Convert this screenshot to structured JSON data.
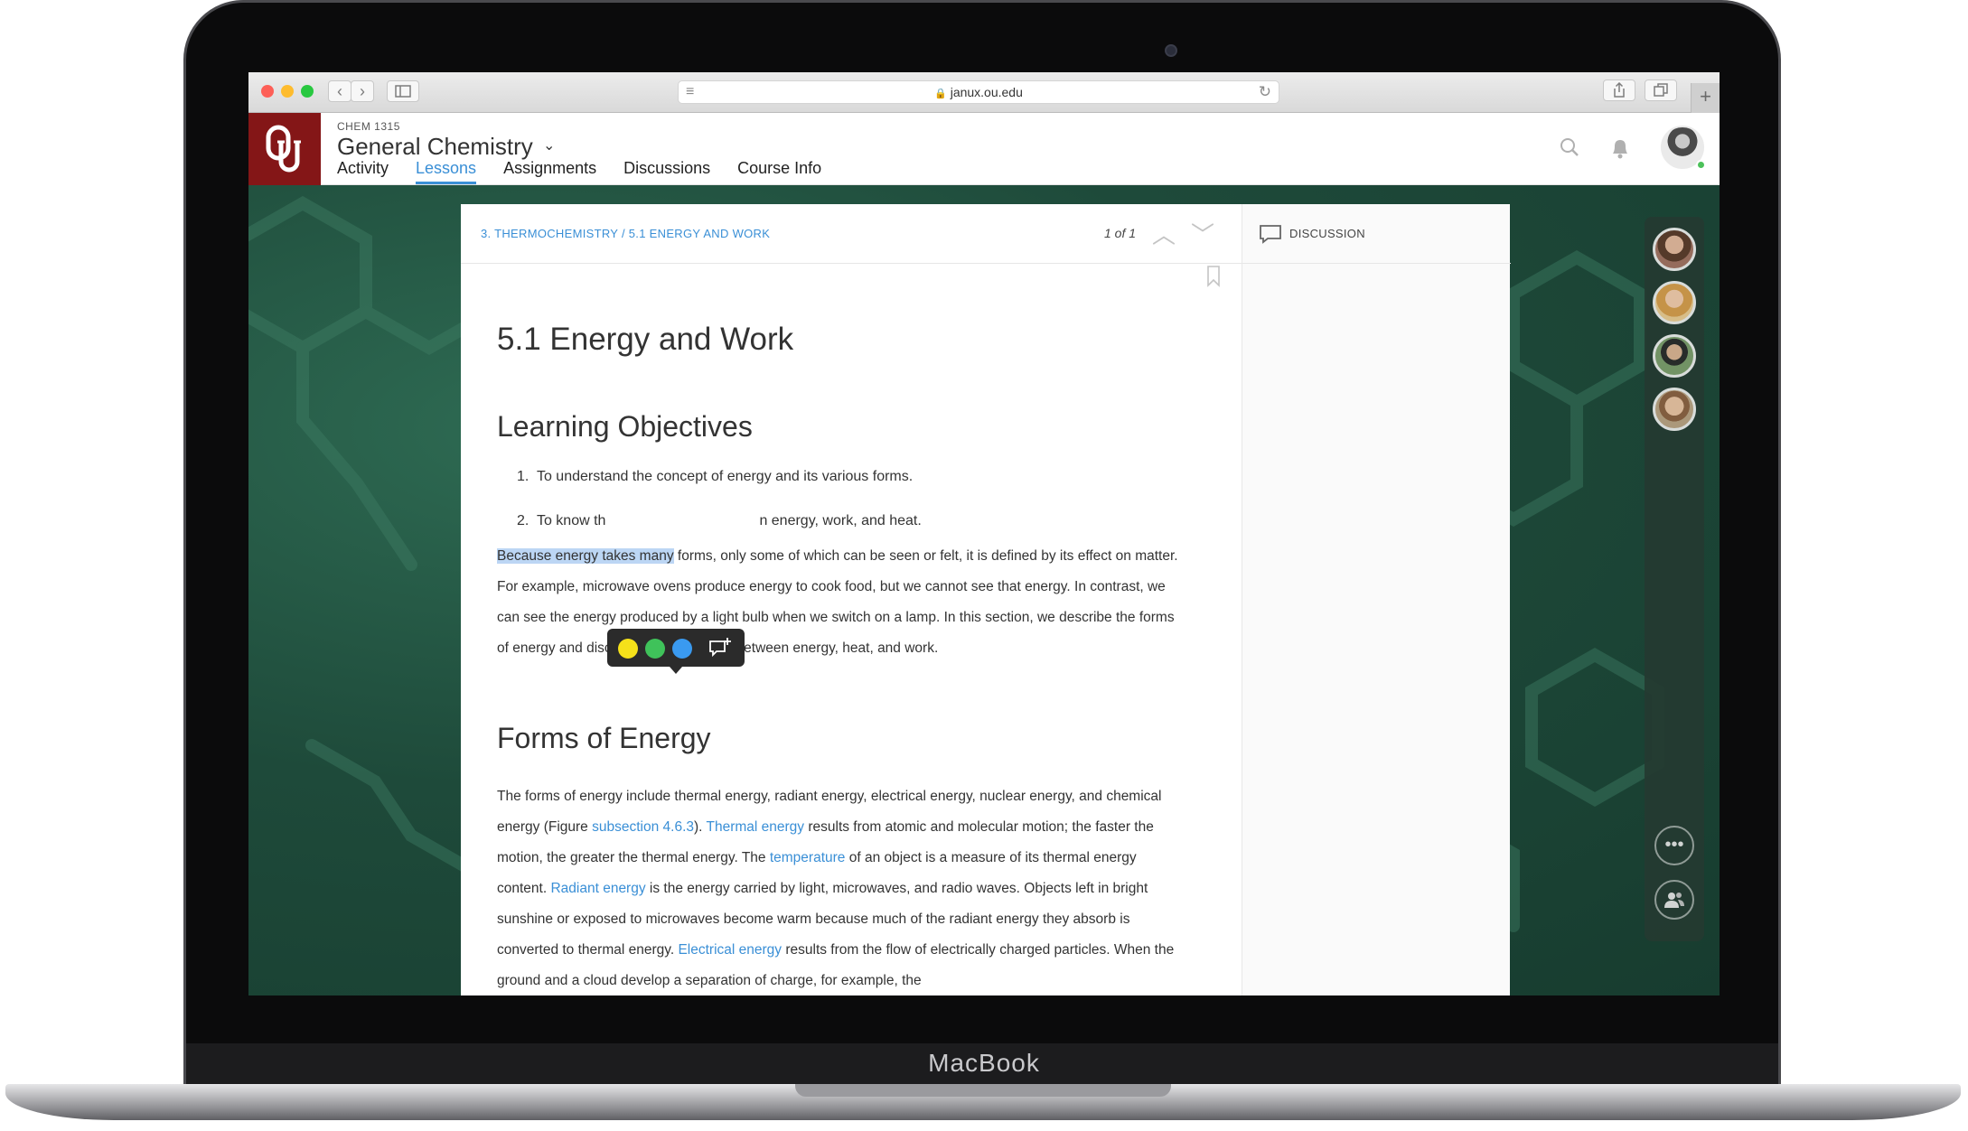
{
  "device": {
    "brand": "MacBook"
  },
  "browser": {
    "url": "janux.ou.edu",
    "buttons": {
      "back": "‹",
      "forward": "›",
      "new_tab": "+"
    }
  },
  "app": {
    "course_code": "CHEM 1315",
    "course_title": "General Chemistry",
    "nav_tabs": [
      "Activity",
      "Lessons",
      "Assignments",
      "Discussions",
      "Course Info"
    ],
    "active_tab": "Lessons",
    "colors": {
      "brand": "#841617",
      "accent": "#3a8fd6",
      "highlight": "#bcd6f4"
    }
  },
  "lesson": {
    "breadcrumb": "3. THERMOCHEMISTRY / 5.1 ENERGY AND WORK",
    "page_counter": "1 of 1",
    "discussion_label": "DISCUSSION",
    "title": "5.1 Energy and Work",
    "objectives_heading": "Learning Objectives",
    "objectives": [
      {
        "num": "1.",
        "text": "To understand the concept of energy and its various forms."
      },
      {
        "num": "2.",
        "text_before": "To know th",
        "text_after": "n energy, work, and heat."
      }
    ],
    "intro": {
      "highlighted": "Because energy takes many",
      "rest": " forms, only some of which can be seen or felt, it is defined by its effect on matter. For example, microwave ovens produce energy to cook food, but we cannot see that energy. In contrast, we can see the energy produced by a light bulb when we switch on a lamp. In this section, we describe the forms of energy and discuss the relationship between energy, heat, and work."
    },
    "forms_heading": "Forms of Energy",
    "forms_paragraph": {
      "t1": "The forms of energy include thermal energy, radiant energy, electrical energy, nuclear energy, and chemical energy (Figure ",
      "l1": "subsection 4.6.3",
      "t2": "). ",
      "l2": "Thermal energy",
      "t3": " results from atomic and molecular motion; the faster the motion, the greater the thermal energy. The ",
      "l3": "temperature",
      "t4": " of an object is a measure of its thermal energy content. ",
      "l4": "Radiant energy",
      "t5": " is the energy carried by light, microwaves, and radio waves. Objects left in bright sunshine or exposed to microwaves become warm because much of the radiant energy they absorb is converted to thermal energy. ",
      "l5": "Electrical energy",
      "t6": " results from the flow of electrically charged particles. When the ground and a cloud develop a separation of charge, for example, the"
    }
  },
  "highlight_toolbar": {
    "colors": [
      "#f5e11a",
      "#3fc25a",
      "#3a9af0"
    ],
    "icon": "add-note-icon"
  },
  "presence_rail": {
    "icons": [
      "more-icon",
      "people-icon"
    ],
    "more_label": "•••"
  }
}
